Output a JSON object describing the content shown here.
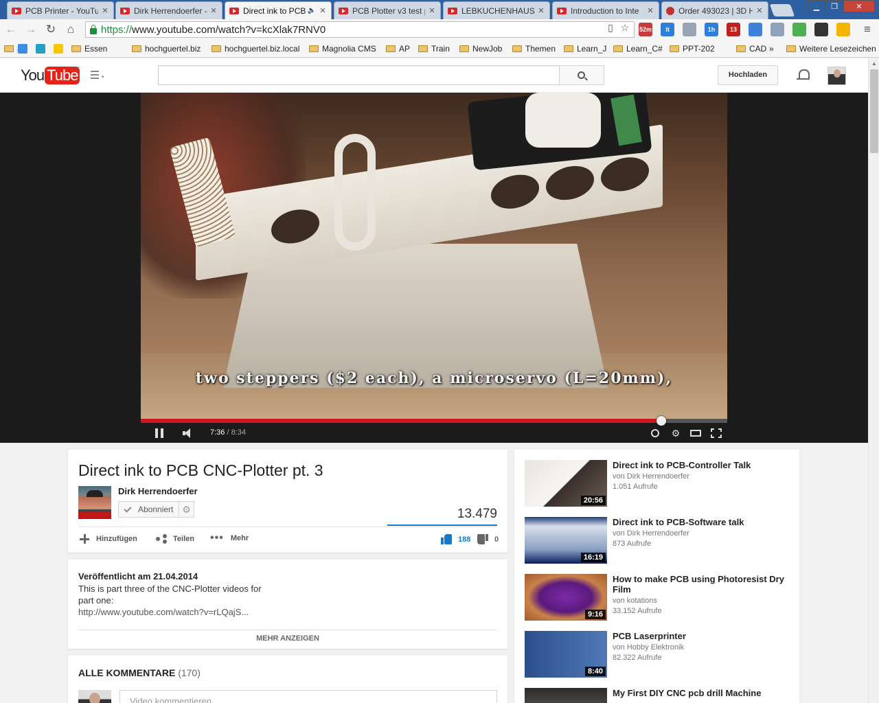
{
  "browser": {
    "tabs": [
      {
        "label": "PCB Printer - YouTub",
        "active": false
      },
      {
        "label": "Dirk Herrendoerfer - ",
        "active": false
      },
      {
        "label": "Direct ink to PCB",
        "active": true
      },
      {
        "label": "PCB Plotter v3 test p",
        "active": false
      },
      {
        "label": "LEBKUCHENHAUS C",
        "active": false
      },
      {
        "label": "Introduction to Inte",
        "active": false
      },
      {
        "label": "Order 493023 | 3D H",
        "active": false
      }
    ],
    "url": {
      "scheme": "https://",
      "rest": "www.youtube.com/watch?v=kcXlak7RNV0"
    },
    "extensions": [
      {
        "name": "calendar-52m-extension",
        "badge": "52m",
        "color": "#c43c3c"
      },
      {
        "name": "instapaper-extension",
        "badge": "it",
        "color": "#2f7ed8"
      },
      {
        "name": "note-extension",
        "badge": "",
        "color": "#9aa5b4"
      },
      {
        "name": "calendar-1h-extension",
        "badge": "1h",
        "color": "#2f7ed8"
      },
      {
        "name": "adblock-plus-extension",
        "badge": "13",
        "color": "#c02020"
      },
      {
        "name": "window-extension",
        "badge": "",
        "color": "#3d82d8"
      },
      {
        "name": "camera-extension",
        "badge": "",
        "color": "#8fa3bd"
      },
      {
        "name": "evernote-extension",
        "badge": "",
        "color": "#4caf50"
      },
      {
        "name": "traffic-extension",
        "badge": "",
        "color": "#333333"
      },
      {
        "name": "google-drive-extension",
        "badge": "",
        "color": "#f4b400"
      }
    ],
    "bookmarks": [
      {
        "label": "#",
        "type": "folder"
      },
      {
        "label": "",
        "type": "site"
      },
      {
        "label": "",
        "type": "site"
      },
      {
        "label": "",
        "type": "site"
      },
      {
        "label": "Essen",
        "type": "folder"
      },
      {
        "label": "hochguertel.biz",
        "type": "folder"
      },
      {
        "label": "hochguertel.biz.local",
        "type": "folder"
      },
      {
        "label": "Magnolia CMS",
        "type": "folder"
      },
      {
        "label": "AP",
        "type": "folder"
      },
      {
        "label": "Train",
        "type": "folder"
      },
      {
        "label": "NewJob",
        "type": "folder"
      },
      {
        "label": "Themen",
        "type": "folder"
      },
      {
        "label": "Learn_J",
        "type": "folder"
      },
      {
        "label": "Learn_C#",
        "type": "folder"
      },
      {
        "label": "PPT-202",
        "type": "folder"
      },
      {
        "label": "CAD",
        "type": "folder"
      }
    ],
    "bookmarks_overflow": "»",
    "other_bookmarks": "Weitere Lesezeichen"
  },
  "youtube": {
    "logo_you": "You",
    "logo_tube": "Tube",
    "region": "DE",
    "search_placeholder": "",
    "upload_label": "Hochladen"
  },
  "player": {
    "subtitle": "two steppers ($2 each), a microservo (L=20mm),",
    "current_time": "7:36",
    "separator": " / ",
    "duration": "8:34",
    "progress": 0.8872
  },
  "video": {
    "title": "Direct ink to PCB CNC-Plotter pt. 3",
    "channel": "Dirk Herrendoerfer",
    "subscribe_label": "Abonniert",
    "views": "13.479",
    "actions": {
      "add": "Hinzufügen",
      "share": "Teilen",
      "more": "Mehr"
    },
    "likes": "188",
    "dislikes": "0"
  },
  "description": {
    "published": "Veröffentlicht am 21.04.2014",
    "lines": [
      "This is part three of the CNC-Plotter videos for",
      "part one:",
      "http://www.youtube.com/watch?v=rLQajS..."
    ],
    "show_more": "MEHR ANZEIGEN"
  },
  "comments": {
    "heading": "ALLE KOMMENTARE",
    "count": "(170)",
    "placeholder": "Video kommentieren"
  },
  "related": [
    {
      "title": "Direct ink to PCB-Controller Talk",
      "channel": "von Dirk Herrendoerfer",
      "views": "1.051 Aufrufe",
      "duration": "20:56"
    },
    {
      "title": "Direct ink to PCB-Software talk",
      "channel": "von Dirk Herrendoerfer",
      "views": "873 Aufrufe",
      "duration": "16:19"
    },
    {
      "title": "How to make PCB using Photoresist Dry Film",
      "channel": "von kotations",
      "views": "33.152 Aufrufe",
      "duration": "9:16"
    },
    {
      "title": "PCB Laserprinter",
      "channel": "von Hobby Elektronik",
      "views": "82.322 Aufrufe",
      "duration": "8:40"
    },
    {
      "title": "My First DIY CNC pcb drill Machine",
      "channel": "",
      "views": "",
      "duration": ""
    }
  ]
}
